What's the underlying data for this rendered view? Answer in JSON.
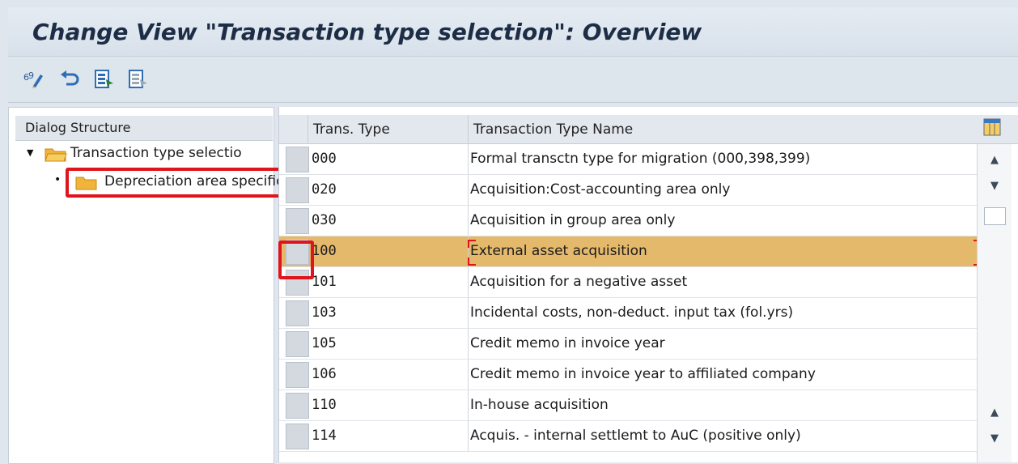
{
  "window": {
    "title": "Change View \"Transaction type selection\": Overview"
  },
  "toolbar": {
    "icons": [
      "display-change-icon",
      "undo-icon",
      "select-all-icon",
      "deselect-all-icon"
    ]
  },
  "dialog_structure": {
    "header": "Dialog Structure",
    "items": [
      {
        "label": "Transaction type selectio",
        "expanded": true,
        "level": 1
      },
      {
        "label": "Depreciation area specification",
        "level": 2
      }
    ]
  },
  "table": {
    "columns": [
      "Trans. Type",
      "Transaction Type Name"
    ],
    "rows": [
      {
        "code": "000",
        "name": "Formal transctn type for migration (000,398,399)"
      },
      {
        "code": "020",
        "name": "Acquisition:Cost-accounting area only"
      },
      {
        "code": "030",
        "name": "Acquisition in group area only"
      },
      {
        "code": "100",
        "name": "External asset acquisition",
        "selected": true
      },
      {
        "code": "101",
        "name": "Acquisition for a negative asset"
      },
      {
        "code": "103",
        "name": "Incidental costs, non-deduct. input tax (fol.yrs)"
      },
      {
        "code": "105",
        "name": "Credit memo in invoice year"
      },
      {
        "code": "106",
        "name": "Credit memo in invoice year to affiliated company"
      },
      {
        "code": "110",
        "name": "In-house acquisition"
      },
      {
        "code": "114",
        "name": "Acquis. - internal settlemt to AuC (positive only)"
      }
    ]
  },
  "colors": {
    "selected_row": "#e4b96b",
    "highlight": "#e0141c",
    "title": "#1d2d46"
  }
}
